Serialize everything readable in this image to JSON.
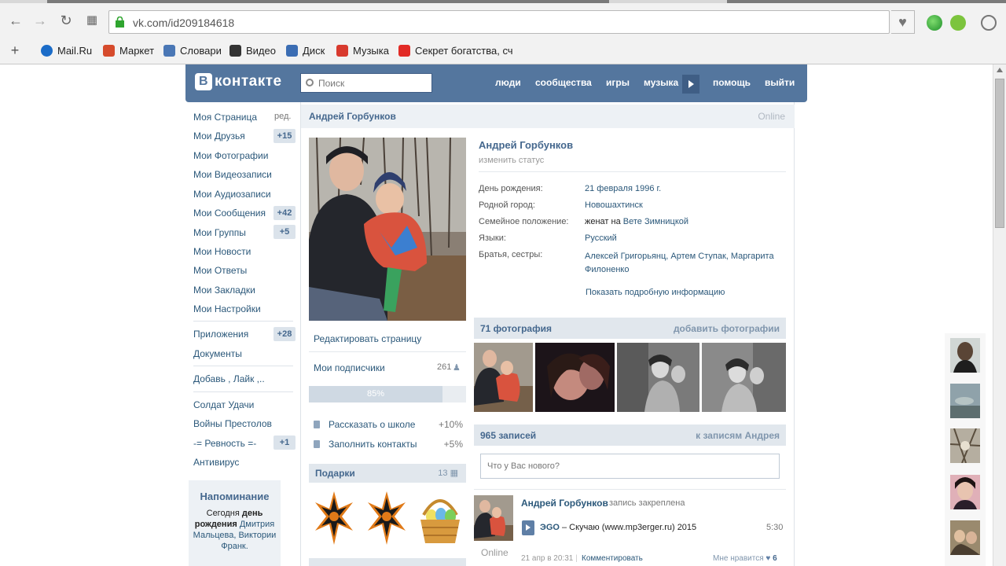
{
  "browser": {
    "url": "vk.com/id209184618",
    "bookmarks": [
      {
        "label": "Mail.Ru",
        "icon": "mailru-icon",
        "color": "#1b6cc8"
      },
      {
        "label": "Маркет",
        "icon": "market-icon",
        "color": "#d64b2c"
      },
      {
        "label": "Словари",
        "icon": "dictionary-icon",
        "color": "#4a77b5"
      },
      {
        "label": "Видео",
        "icon": "video-icon",
        "color": "#333333"
      },
      {
        "label": "Диск",
        "icon": "disk-icon",
        "color": "#3b6db3"
      },
      {
        "label": "Музыка",
        "icon": "music-icon",
        "color": "#d83a2e"
      },
      {
        "label": "Секрет богатства, сч",
        "icon": "youtube-icon",
        "color": "#e22b26"
      }
    ]
  },
  "vk": {
    "logo": "контакте",
    "logo_mark": "В",
    "search_placeholder": "Поиск",
    "nav": [
      "люди",
      "сообщества",
      "игры",
      "музыка",
      "помощь",
      "выйти"
    ],
    "colors": {
      "header": "#54769e",
      "link": "#2b587a",
      "accent": "#45688e"
    }
  },
  "left_menu": {
    "items": [
      {
        "label": "Моя Страница",
        "extra": "ред."
      },
      {
        "label": "Мои Друзья",
        "count": "+15"
      },
      {
        "label": "Мои Фотографии"
      },
      {
        "label": "Мои Видеозаписи"
      },
      {
        "label": "Мои Аудиозаписи"
      },
      {
        "label": "Мои Сообщения",
        "count": "+42"
      },
      {
        "label": "Мои Группы",
        "count": "+5"
      },
      {
        "label": "Мои Новости"
      },
      {
        "label": "Мои Ответы"
      },
      {
        "label": "Мои Закладки"
      },
      {
        "label": "Мои Настройки"
      }
    ],
    "apps": [
      {
        "label": "Приложения",
        "count": "+28"
      },
      {
        "label": "Документы"
      }
    ],
    "extra": [
      {
        "label": "Добавь , Лайк ,.."
      }
    ],
    "groups": [
      {
        "label": "Солдат Удачи"
      },
      {
        "label": "Войны Престолов"
      },
      {
        "label": "-= Ревность =-",
        "count": "+1"
      },
      {
        "label": "Антивирус"
      }
    ],
    "reminder": {
      "title": "Напоминание",
      "text_1": "Сегодня ",
      "text_bold": "день рождения",
      "text_2": " ",
      "link": "Дмитрия Мальцева, Виктории Франк."
    }
  },
  "profile": {
    "name": "Андрей Горбунков",
    "online": "Online",
    "status_placeholder": "изменить статус",
    "edit_page": "Редактировать страницу",
    "followers_label": "Мои подписчики",
    "followers_count": "261",
    "completion": 0.85,
    "completion_label": "85%",
    "tasks": [
      {
        "label": "Рассказать о школе",
        "pct": "+10%"
      },
      {
        "label": "Заполнить контакты",
        "pct": "+5%"
      }
    ],
    "gifts_label": "Подарки",
    "gifts_count": "13",
    "info": [
      {
        "label": "День рождения:",
        "value": "21 февраля 1996 г."
      },
      {
        "label": "Родной город:",
        "value": "Новошахтинск"
      },
      {
        "label": "Семейное положение:",
        "value_prefix": "женат на ",
        "value": "Вете Зимницкой"
      },
      {
        "label": "Языки:",
        "value": "Русский"
      },
      {
        "label": "Братья, сестры:",
        "value": "Алексей Григорьянц, Артем Ступак, Маргарита Филоненко"
      }
    ],
    "more_info": "Показать подробную информацию",
    "photos_label": "71 фотография",
    "add_photos": "добавить фотографии",
    "posts_label": "965 записей",
    "to_posts": "к записям Андрея",
    "wall_placeholder": "Что у Вас нового?"
  },
  "post": {
    "author": "Андрей Горбунков",
    "pinned": "запись закреплена",
    "audio_artist": "ЭGO",
    "audio_title": " – Скучаю (www.mp3erger.ru) 2015",
    "audio_duration": "5:30",
    "date": "21 апр в 20:31",
    "separator": "|",
    "comment": "Комментировать",
    "like_label": "Мне нравится",
    "like_count": "6",
    "online": "Online"
  }
}
